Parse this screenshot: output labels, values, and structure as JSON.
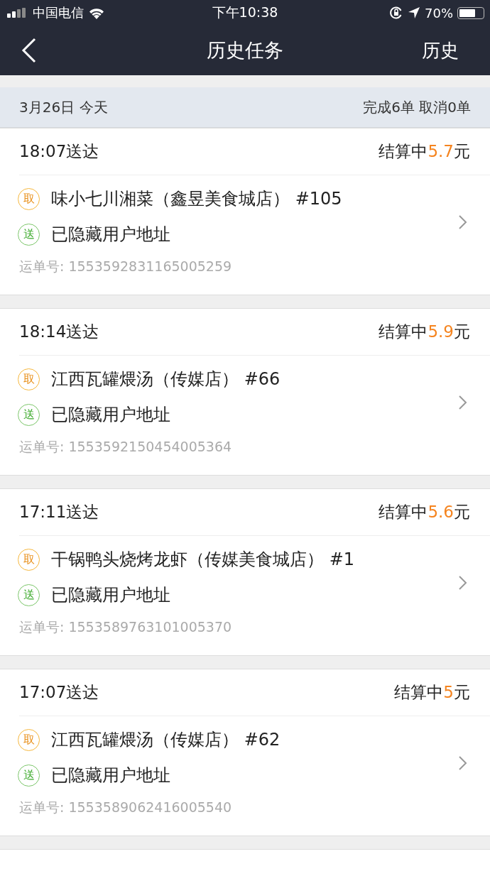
{
  "status_bar": {
    "carrier": "中国电信",
    "time": "下午10:38",
    "battery": "70%"
  },
  "nav": {
    "title": "历史任务",
    "right": "历史"
  },
  "day": {
    "date": "3月26日 今天",
    "summary": "完成6单 取消0单"
  },
  "orders": [
    {
      "time": "18:07送达",
      "status": "结算中",
      "amount": "5.7",
      "unit": "元",
      "stops": [
        {
          "kind": "pickup",
          "badge": "取",
          "text": "味小七川湘菜（鑫昱美食城店） #105"
        },
        {
          "kind": "dropoff",
          "badge": "送",
          "text": "已隐藏用户地址"
        }
      ],
      "waybill": "运单号: 1553592831165005259"
    },
    {
      "time": "18:14送达",
      "status": "结算中",
      "amount": "5.9",
      "unit": "元",
      "stops": [
        {
          "kind": "pickup",
          "badge": "取",
          "text": "江西瓦罐煨汤（传媒店） #66"
        },
        {
          "kind": "dropoff",
          "badge": "送",
          "text": "已隐藏用户地址"
        }
      ],
      "waybill": "运单号: 1553592150454005364"
    },
    {
      "time": "17:11送达",
      "status": "结算中",
      "amount": "5.6",
      "unit": "元",
      "stops": [
        {
          "kind": "pickup",
          "badge": "取",
          "text": "干锅鸭头烧烤龙虾（传媒美食城店） #1"
        },
        {
          "kind": "dropoff",
          "badge": "送",
          "text": "已隐藏用户地址"
        }
      ],
      "waybill": "运单号: 1553589763101005370"
    },
    {
      "time": "17:07送达",
      "status": "结算中",
      "amount": "5",
      "unit": "元",
      "stops": [
        {
          "kind": "pickup",
          "badge": "取",
          "text": "江西瓦罐煨汤（传媒店） #62"
        },
        {
          "kind": "dropoff",
          "badge": "送",
          "text": "已隐藏用户地址"
        }
      ],
      "waybill": "运单号: 1553589062416005540"
    }
  ]
}
